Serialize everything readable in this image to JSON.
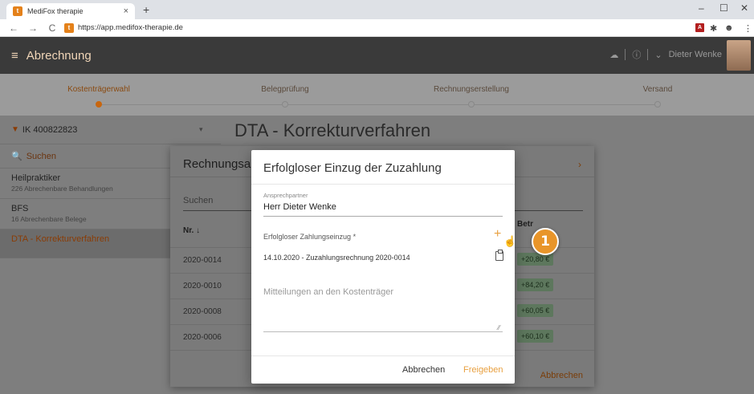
{
  "browser": {
    "tab_title": "MediFox therapie",
    "tab_close": "×",
    "new_tab": "+",
    "url": "https://app.medifox-therapie.de",
    "favicon_letter": "t"
  },
  "app": {
    "title": "Abrechnung",
    "user": "Dieter Wenke"
  },
  "stepper": {
    "steps": [
      "Kostenträgerwahl",
      "Belegprüfung",
      "Rechnungserstellung",
      "Versand"
    ]
  },
  "sidebar": {
    "filter": "IK 400822823",
    "search": "Suchen",
    "items": [
      {
        "title": "Heilpraktiker",
        "subtitle": "226 Abrechenbare Behandlungen"
      },
      {
        "title": "BFS",
        "subtitle": "16 Abrechenbare Belege"
      },
      {
        "title": "DTA - Korrekturverfahren",
        "subtitle": ""
      }
    ]
  },
  "main": {
    "title": "DTA - Korrekturverfahren"
  },
  "under_modal": {
    "title": "Rechnungsa",
    "search_placeholder": "Suchen",
    "col_nr": "Nr. ↓",
    "col_betrag": "Betr",
    "rows": [
      {
        "nr": "2020-0014",
        "amount": "+20,80 €"
      },
      {
        "nr": "2020-0010",
        "amount": "+84,20 €"
      },
      {
        "nr": "2020-0008",
        "amount": "+60,05 €"
      },
      {
        "nr": "2020-0006",
        "amount": "+60,10 €"
      }
    ],
    "cancel": "Abbrechen"
  },
  "modal": {
    "title": "Erfolgloser Einzug der Zuzahlung",
    "contact_label": "Ansprechpartner",
    "contact_value": "Herr Dieter Wenke",
    "field_label": "Erfolgloser Zahlungseinzug *",
    "entry": "14.10.2020 - Zuzahlungsrechnung 2020-0014",
    "notes_placeholder": "Mitteilungen an den Kostenträger",
    "cancel": "Abbrechen",
    "release": "Freigeben"
  },
  "callout": "1",
  "colors": {
    "accent": "#e8a040",
    "header": "#3a3a3a",
    "active_item": "#8a3c05"
  }
}
